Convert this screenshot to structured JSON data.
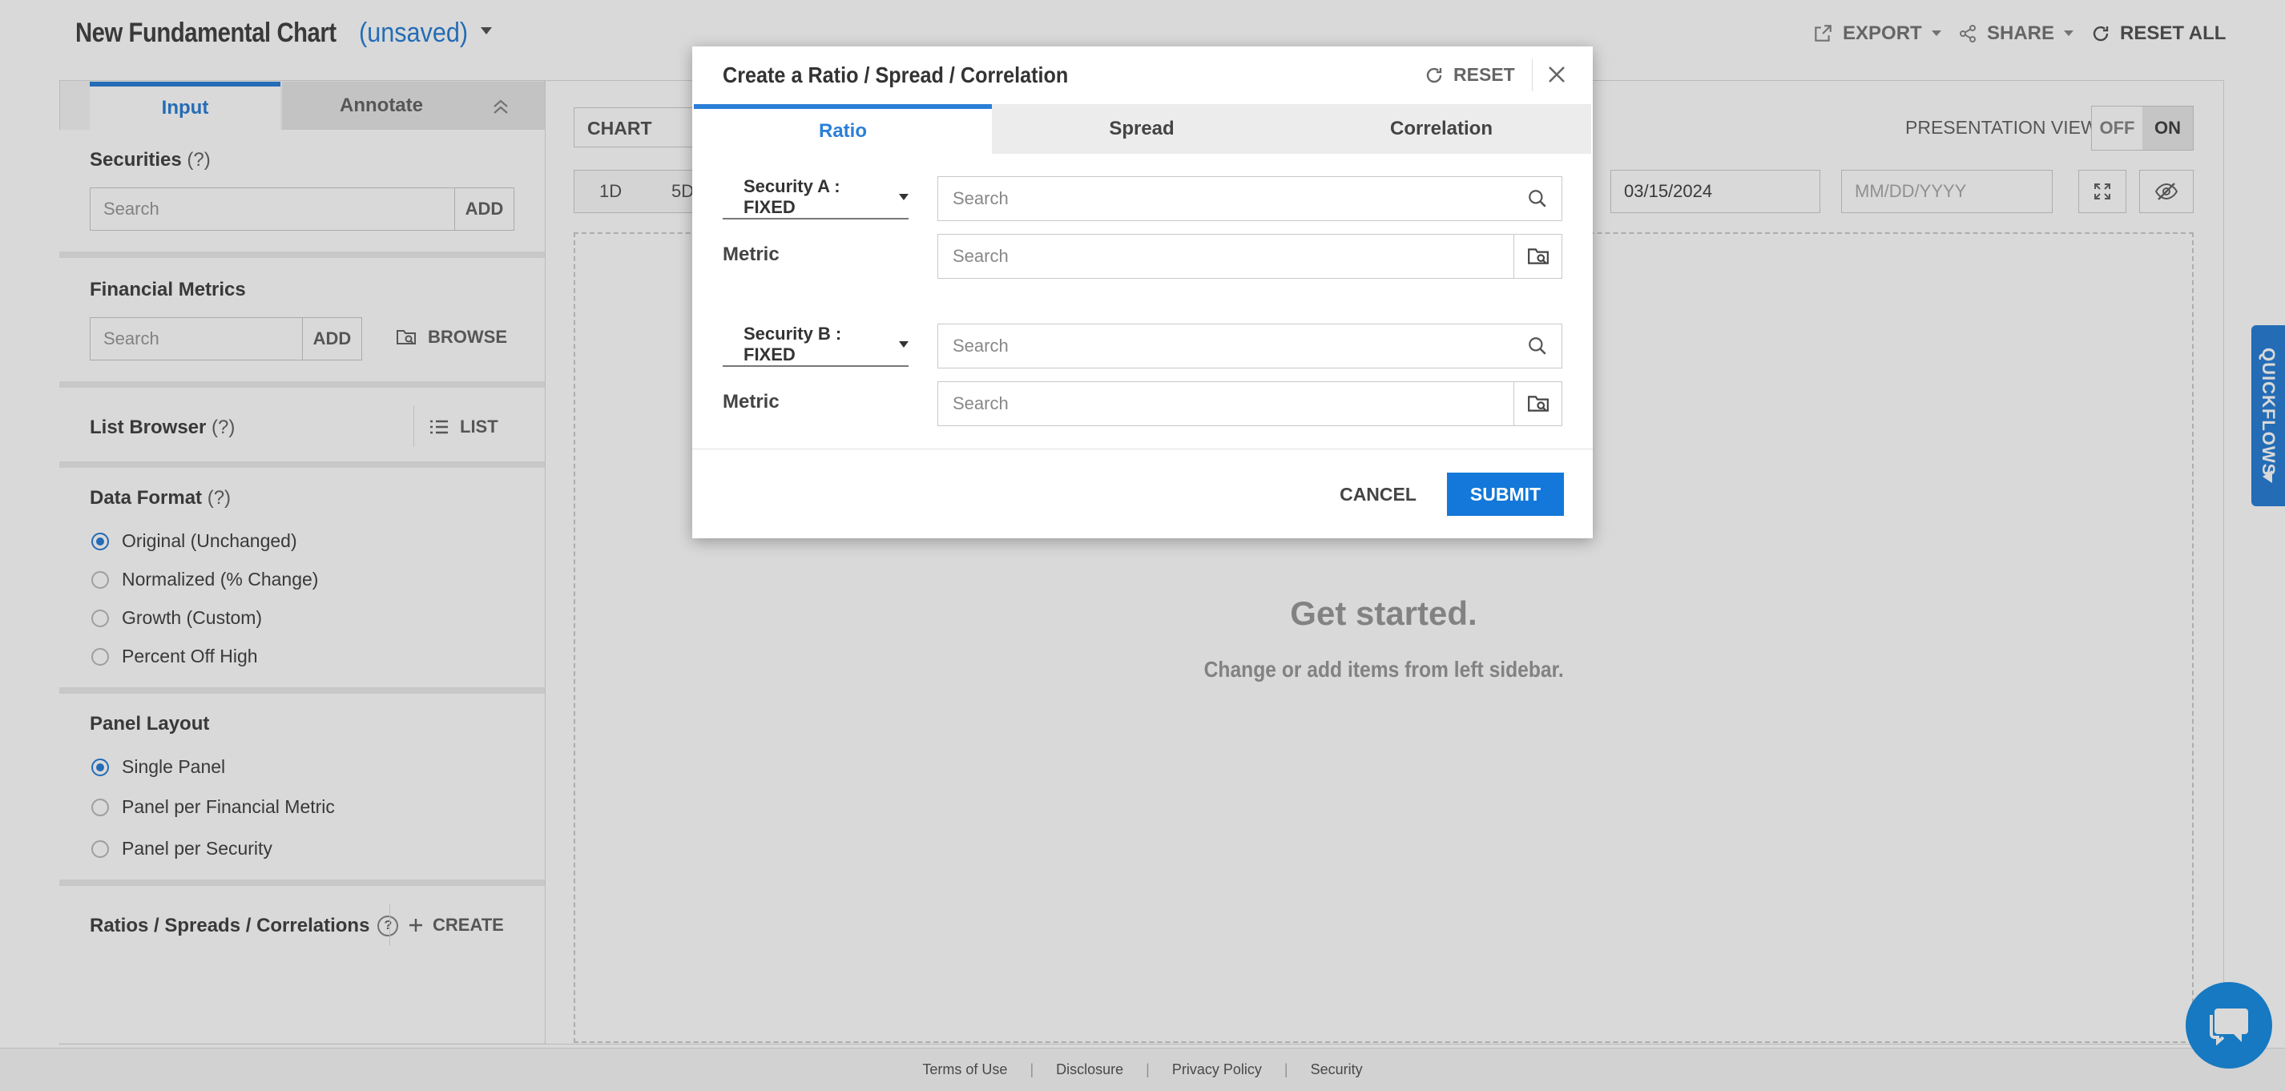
{
  "header": {
    "title": "New Fundamental Chart",
    "unsaved": "(unsaved)",
    "export_label": "EXPORT",
    "share_label": "SHARE",
    "reset_all_label": "RESET ALL"
  },
  "sidebar": {
    "tabs": [
      "Input",
      "Annotate"
    ],
    "securities": {
      "label": "Securities",
      "help": "(?)",
      "placeholder": "Search",
      "add": "ADD"
    },
    "metrics": {
      "label": "Financial Metrics",
      "placeholder": "Search",
      "add": "ADD",
      "browse": "BROWSE"
    },
    "list_browser": {
      "label": "List Browser",
      "help": "(?)",
      "list": "LIST"
    },
    "data_format": {
      "label": "Data Format",
      "help": "(?)",
      "options": [
        "Original (Unchanged)",
        "Normalized (% Change)",
        "Growth (Custom)",
        "Percent Off High"
      ],
      "selected": 0
    },
    "panel_layout": {
      "label": "Panel Layout",
      "options": [
        "Single Panel",
        "Panel per Financial Metric",
        "Panel per Security"
      ],
      "selected": 0
    },
    "ratios": {
      "label": "Ratios / Spreads / Correlations",
      "help": "?",
      "create": "CREATE"
    }
  },
  "main": {
    "chart_options": "CHART OPTIONS",
    "ranges": [
      "1D",
      "5D"
    ],
    "start_date": "03/15/2024",
    "end_placeholder": "MM/DD/YYYY",
    "presentation_view": "PRESENTATION VIEW",
    "toggle_off": "OFF",
    "toggle_on": "ON",
    "get_started": "Get started.",
    "get_started_sub": "Change or add items from left sidebar."
  },
  "modal": {
    "title": "Create a Ratio / Spread / Correlation",
    "reset": "RESET",
    "tabs": [
      "Ratio",
      "Spread",
      "Correlation"
    ],
    "active_tab": 0,
    "security_a": "Security A : FIXED",
    "security_b": "Security B : FIXED",
    "metric_label": "Metric",
    "search_placeholder": "Search",
    "cancel": "CANCEL",
    "submit": "SUBMIT"
  },
  "footer": {
    "links": [
      "Terms of Use",
      "Disclosure",
      "Privacy Policy",
      "Security"
    ]
  },
  "quickflows": {
    "label": "QUICKFLOWS"
  },
  "colors": {
    "accent": "#2b7fd6",
    "submit": "#1378d9",
    "chat": "#1a8fe3"
  }
}
